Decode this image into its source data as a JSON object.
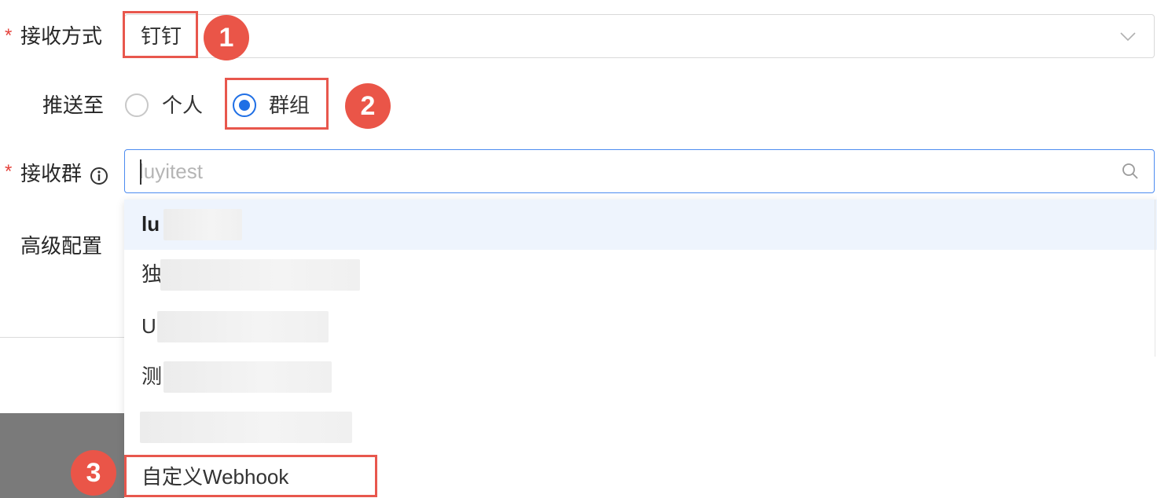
{
  "form": {
    "receive_method": {
      "label": "接收方式",
      "required_mark": "*",
      "value": "钉钉"
    },
    "push_to": {
      "label": "推送至",
      "options": [
        {
          "label": "个人",
          "checked": false
        },
        {
          "label": "群组",
          "checked": true
        }
      ]
    },
    "receive_group": {
      "label": "接收群",
      "required_mark": "*",
      "info_icon": "info-icon",
      "search_value": "luyitest"
    },
    "advanced": {
      "label": "高级配置"
    }
  },
  "dropdown": {
    "options": [
      {
        "label": "lu"
      },
      {
        "label": "独"
      },
      {
        "label": "U"
      },
      {
        "label": "测"
      },
      {
        "label": ""
      },
      {
        "label": "自定义Webhook"
      }
    ]
  },
  "annotations": {
    "badges": [
      "1",
      "2",
      "3"
    ]
  },
  "colors": {
    "accent": "#1f6fe5",
    "annotation": "#e8574d",
    "required": "#e5443d"
  }
}
